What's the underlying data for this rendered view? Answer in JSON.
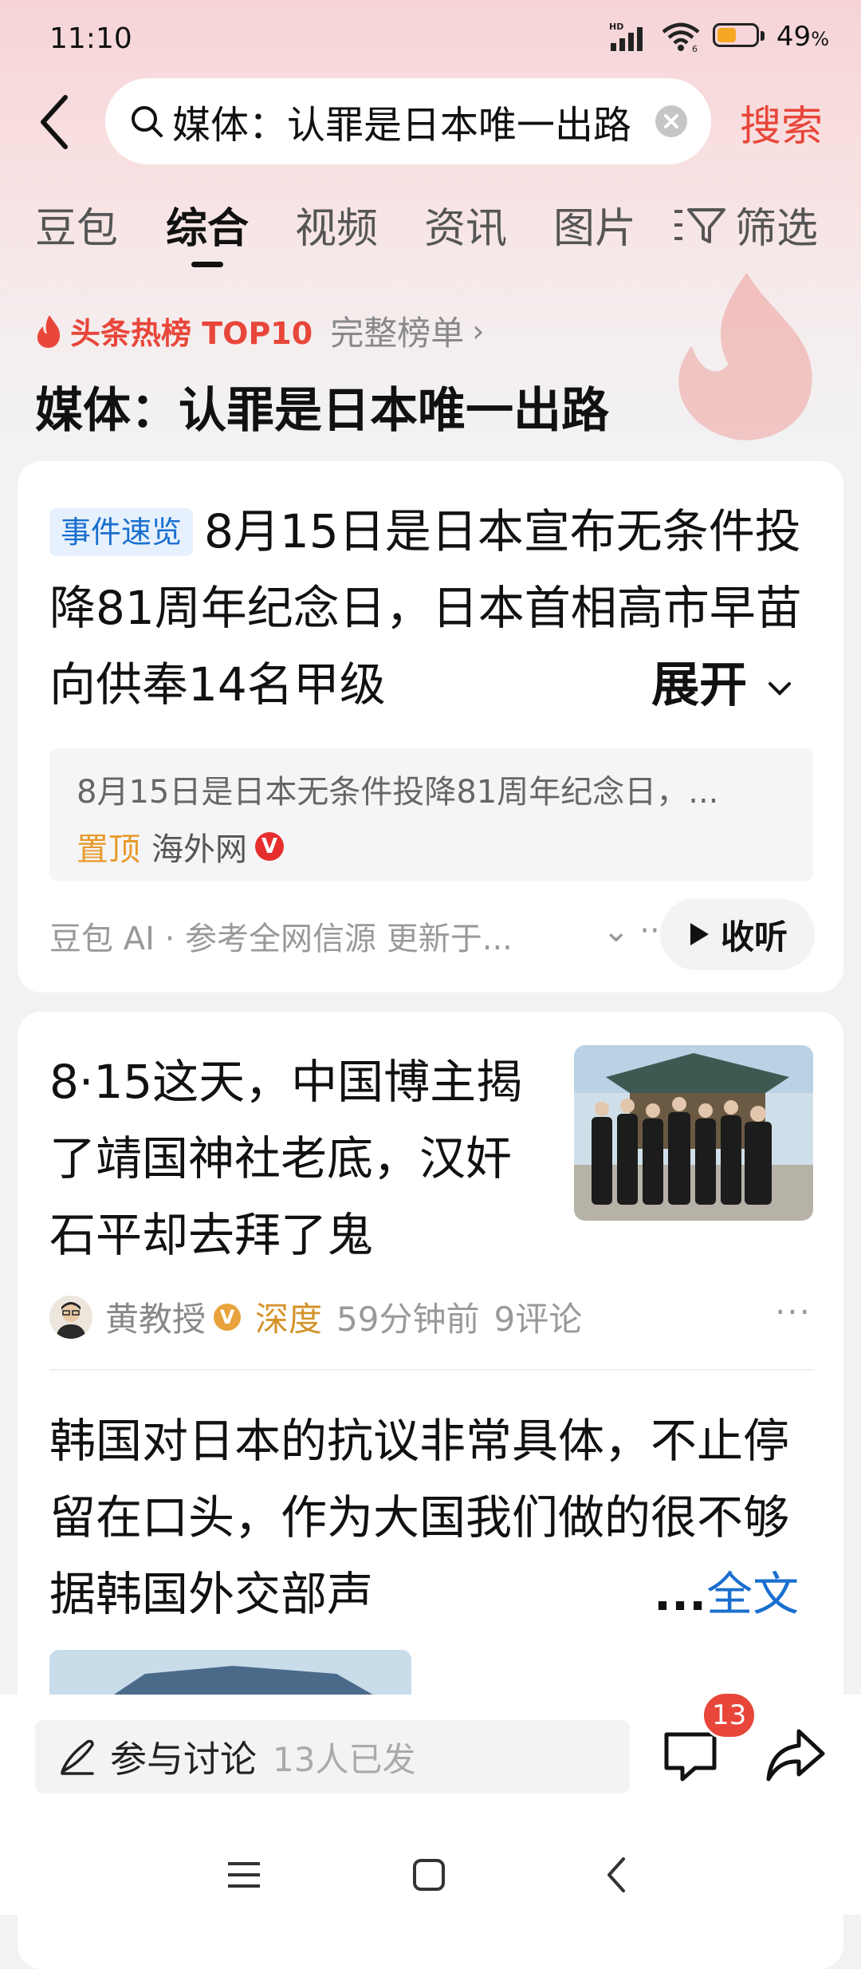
{
  "status_bar": {
    "time": "11:10",
    "network": "HD",
    "battery_percent": "49",
    "battery_unit": "%",
    "battery_level": 0.49
  },
  "search": {
    "query": "媒体：认罪是日本唯一出路",
    "button_label": "搜索"
  },
  "tabs": [
    {
      "label": "豆包"
    },
    {
      "label": "综合",
      "active": true
    },
    {
      "label": "视频"
    },
    {
      "label": "资讯"
    },
    {
      "label": "图片"
    }
  ],
  "filter_label": "筛选",
  "hot_list": {
    "label": "头条热榜 TOP10",
    "full_list": "完整榜单",
    "chevron": "›"
  },
  "headline": "媒体：认罪是日本唯一出路",
  "ai_summary": {
    "badge": "事件速览",
    "text": "8月15日是日本宣布无条件投降81周年纪念日，日本首相高市早苗向供奉14名甲级",
    "expand_label": "展开",
    "quote": {
      "text": "8月15日是日本无条件投降81周年纪念日，...",
      "pin_label": "置顶",
      "source": "海外网",
      "verified": "V"
    },
    "footnote": "豆包 AI · 参考全网信源 更新于...",
    "listen_label": "收听"
  },
  "article": {
    "title": "8·15这天，中国博主揭了靖国神社老底，汉奸石平却去拜了鬼",
    "author": "黄教授",
    "verified": "V",
    "tag": "深度",
    "time_ago": "59分钟前",
    "comments": "9评论"
  },
  "comment": {
    "text": "韩国对日本的抗议非常具体，不止停留在口头，作为大国我们做的很不够据韩国外交部声",
    "ellipsis": "...",
    "full_label": "全文"
  },
  "bottom_bar": {
    "discuss_label": "参与讨论",
    "participants": "13人已发",
    "comment_count": "13"
  },
  "colors": {
    "accent_red": "#e8463a",
    "link_blue": "#1a6fcf",
    "gold": "#d4932a"
  },
  "icons": [
    "back-icon",
    "search-icon",
    "clear-icon",
    "filter-icon",
    "fire-icon",
    "chevron-down-icon",
    "play-icon",
    "more-icon",
    "pen-icon",
    "comment-icon",
    "share-icon",
    "menu-icon",
    "home-icon",
    "back-nav-icon"
  ]
}
